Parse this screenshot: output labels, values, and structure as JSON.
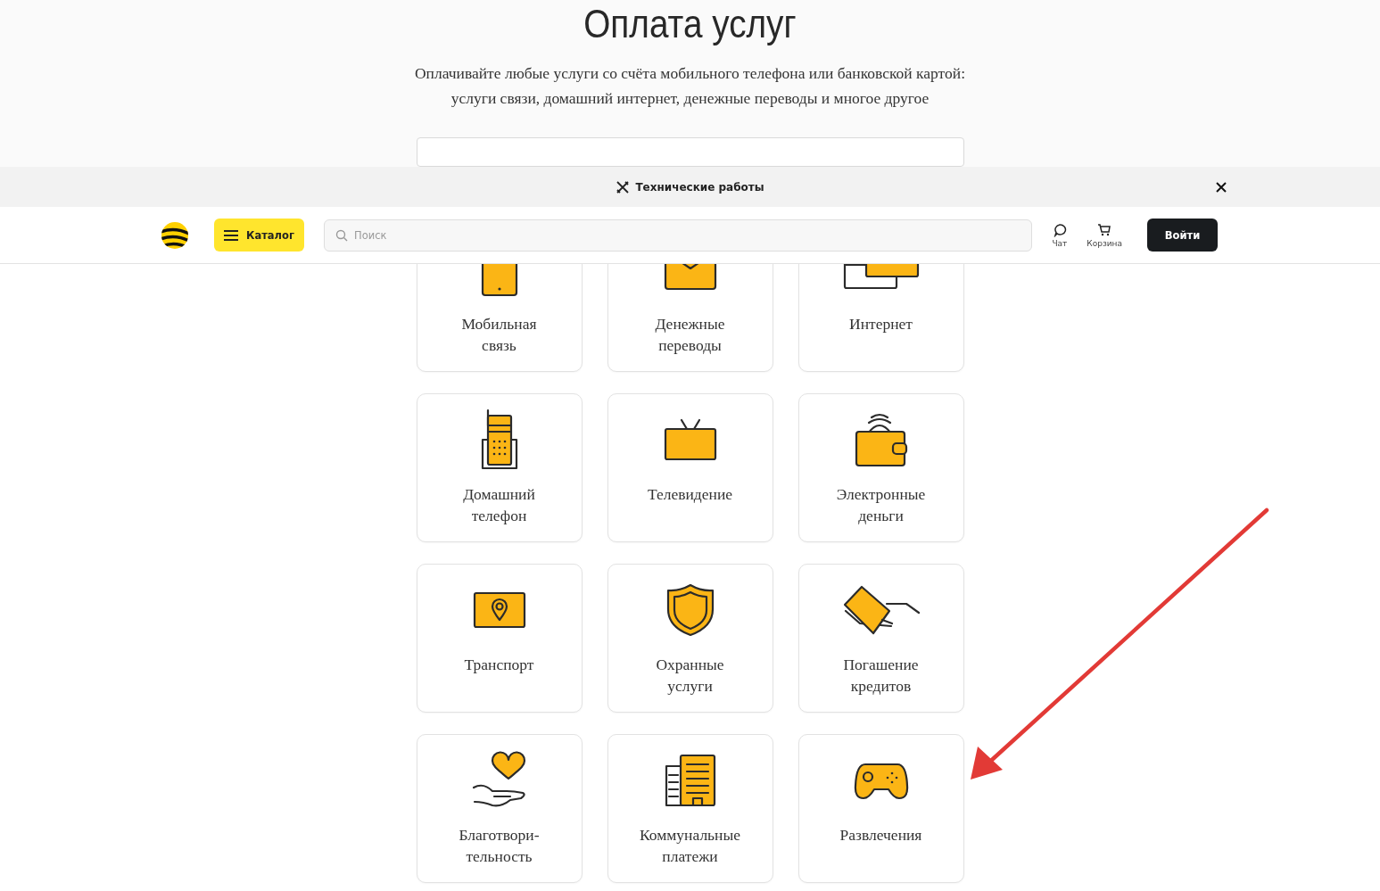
{
  "hero": {
    "title": "Оплата услуг",
    "subtitle": "Оплачивайте любые услуги со счёта мобильного телефона или банковской картой:\nуслуги связи, домашний интернет, денежные переводы и многое другое"
  },
  "notice": {
    "text": "Технические работы"
  },
  "header": {
    "catalog": "Каталог",
    "search": {
      "placeholder": "Поиск"
    },
    "actions": [
      {
        "label": "Чат"
      },
      {
        "label": "Корзина"
      }
    ],
    "login": "Войти"
  },
  "tiles": [
    {
      "label": "Мобильная\nсвязь"
    },
    {
      "label": "Денежные\nпереводы"
    },
    {
      "label": "Интернет"
    },
    {
      "label": "Домашний\nтелефон"
    },
    {
      "label": "Телевидение"
    },
    {
      "label": "Электронные\nденьги"
    },
    {
      "label": "Транспорт"
    },
    {
      "label": "Охранные\nуслуги"
    },
    {
      "label": "Погашение\nкредитов"
    },
    {
      "label": "Благотвори-\nтельность"
    },
    {
      "label": "Коммунальные\nплатежи"
    },
    {
      "label": "Развлечения"
    }
  ]
}
